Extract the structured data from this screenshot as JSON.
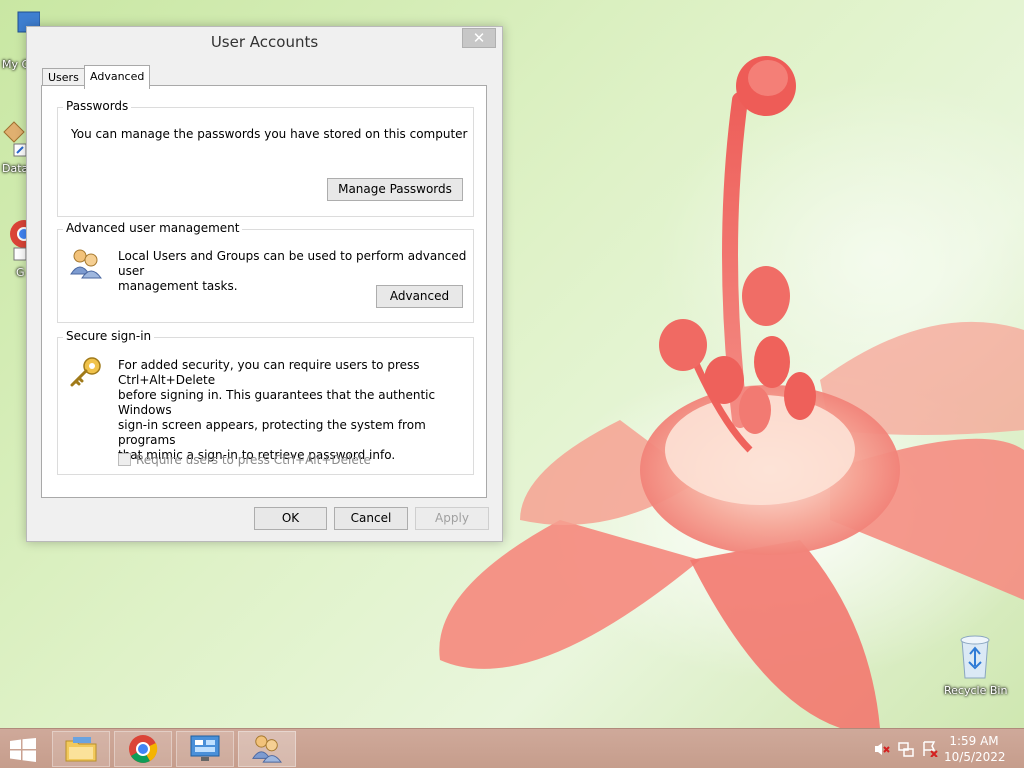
{
  "window": {
    "title": "User Accounts",
    "close_glyph": "✕",
    "tabs": [
      {
        "label": "Users",
        "active": false
      },
      {
        "label": "Advanced",
        "active": true
      }
    ]
  },
  "passwords": {
    "label": "Passwords",
    "text": "You can manage the passwords you have stored on this computer",
    "button": "Manage Passwords"
  },
  "advanced_mgmt": {
    "label": "Advanced user management",
    "text_line1": "Local Users and Groups can be used to perform advanced user",
    "text_line2": "management tasks.",
    "button": "Advanced",
    "icon": "users-icon"
  },
  "secure_signin": {
    "label": "Secure sign-in",
    "text_line1": "For added security, you can require users to press Ctrl+Alt+Delete",
    "text_line2": "before signing in. This guarantees that the authentic Windows",
    "text_line3": "sign-in screen appears, protecting the system from programs",
    "text_line4": "that mimic a sign-in to retrieve password info.",
    "checkbox_label": "Require users to press Ctrl+Alt+Delete",
    "checkbox_checked": false,
    "checkbox_enabled": false,
    "icon": "key-icon"
  },
  "footer": {
    "ok": "OK",
    "cancel": "Cancel",
    "apply": "Apply"
  },
  "desktop": {
    "icons": [
      {
        "label": "My C",
        "icon": "computer-icon"
      },
      {
        "label": "Data",
        "icon": "shortcut-icon"
      },
      {
        "label": "G",
        "icon": "chrome-shortcut-icon"
      },
      {
        "label": "Recycle Bin",
        "icon": "recycle-bin-icon"
      }
    ]
  },
  "taskbar": {
    "items": [
      "file-explorer-icon",
      "chrome-icon",
      "control-panel-icon",
      "user-accounts-icon"
    ],
    "tray": [
      "volume-muted-icon",
      "network-icon",
      "action-center-icon"
    ],
    "time": "1:59 AM",
    "date": "10/5/2022"
  },
  "colors": {
    "taskbar": "#c69d8c",
    "window_bg": "#f0f0f0",
    "flower": "#f07a72"
  }
}
